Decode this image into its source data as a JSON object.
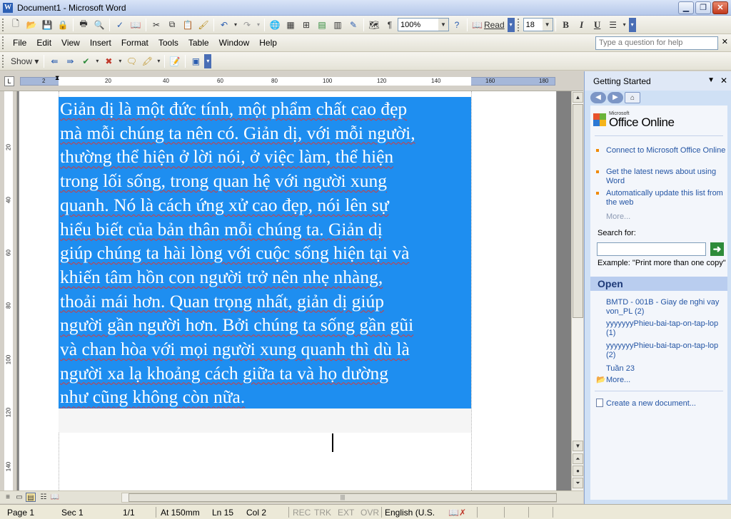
{
  "window": {
    "title": "Document1 - Microsoft Word",
    "app_icon": "W"
  },
  "toolbar": {
    "zoom": "100%",
    "read_label": "Read",
    "font_size": "18",
    "bold": "B",
    "italic": "I",
    "underline": "U"
  },
  "menu": {
    "items": [
      "File",
      "Edit",
      "View",
      "Insert",
      "Format",
      "Tools",
      "Table",
      "Window",
      "Help"
    ],
    "help_placeholder": "Type a question for help"
  },
  "reviewing": {
    "show_label": "Show"
  },
  "ruler": {
    "h_ticks": [
      "2",
      "20",
      "40",
      "60",
      "80",
      "100",
      "120",
      "140",
      "160",
      "180"
    ],
    "v_ticks": [
      "20",
      "40",
      "60",
      "80",
      "100",
      "120",
      "140"
    ]
  },
  "document": {
    "lines": [
      "Giản dị là một đức tính, một phẩm chất cao đẹp",
      "mà mỗi chúng ta nên có. Giản dị, với mỗi người,",
      "thường thể hiện ở lời nói, ở việc làm, thể hiện",
      "trong lối sống, trong quan hệ với người xung",
      "quanh. Nó là cách ứng xử cao đẹp, nói lên sự",
      "hiểu biết của bản thân mỗi chúng ta. Giản dị",
      "giúp chúng ta hài lòng với cuộc sống hiện tại và",
      "khiến tâm hồn con người trở nên nhẹ nhàng,",
      "thoải mái hơn. Quan trọng nhất, giản dị giúp",
      "người gần người hơn. Bởi chúng ta sống gần gũi",
      "và chan hòa với mọi người xung quanh thì dù là",
      "người xa lạ khoảng cách giữa ta và họ dường",
      "như cũng không còn nữa."
    ]
  },
  "statusbar": {
    "page": "Page 1",
    "sec": "Sec 1",
    "pages": "1/1",
    "at": "At 150mm",
    "ln": "Ln 15",
    "col": "Col 2",
    "rec": "REC",
    "trk": "TRK",
    "ext": "EXT",
    "ovr": "OVR",
    "language": "English (U.S."
  },
  "taskpane": {
    "title": "Getting Started",
    "logo_small": "Microsoft",
    "logo_big": "Office Online",
    "links": [
      "Connect to Microsoft Office Online",
      "Get the latest news about using Word",
      "Automatically update this list from the web"
    ],
    "more": "More...",
    "search_label": "Search for:",
    "search_value": "",
    "example": "Example:  \"Print more than one copy\"",
    "open_heading": "Open",
    "open_items": [
      "BMTD - 001B - Giay de nghi vay von_PL (2)",
      "yyyyyyyPhieu-bai-tap-on-tap-lop (1)",
      "yyyyyyyPhieu-bai-tap-on-tap-lop (2)",
      "Tuần 23"
    ],
    "open_more": "More...",
    "create_new": "Create a new document..."
  }
}
